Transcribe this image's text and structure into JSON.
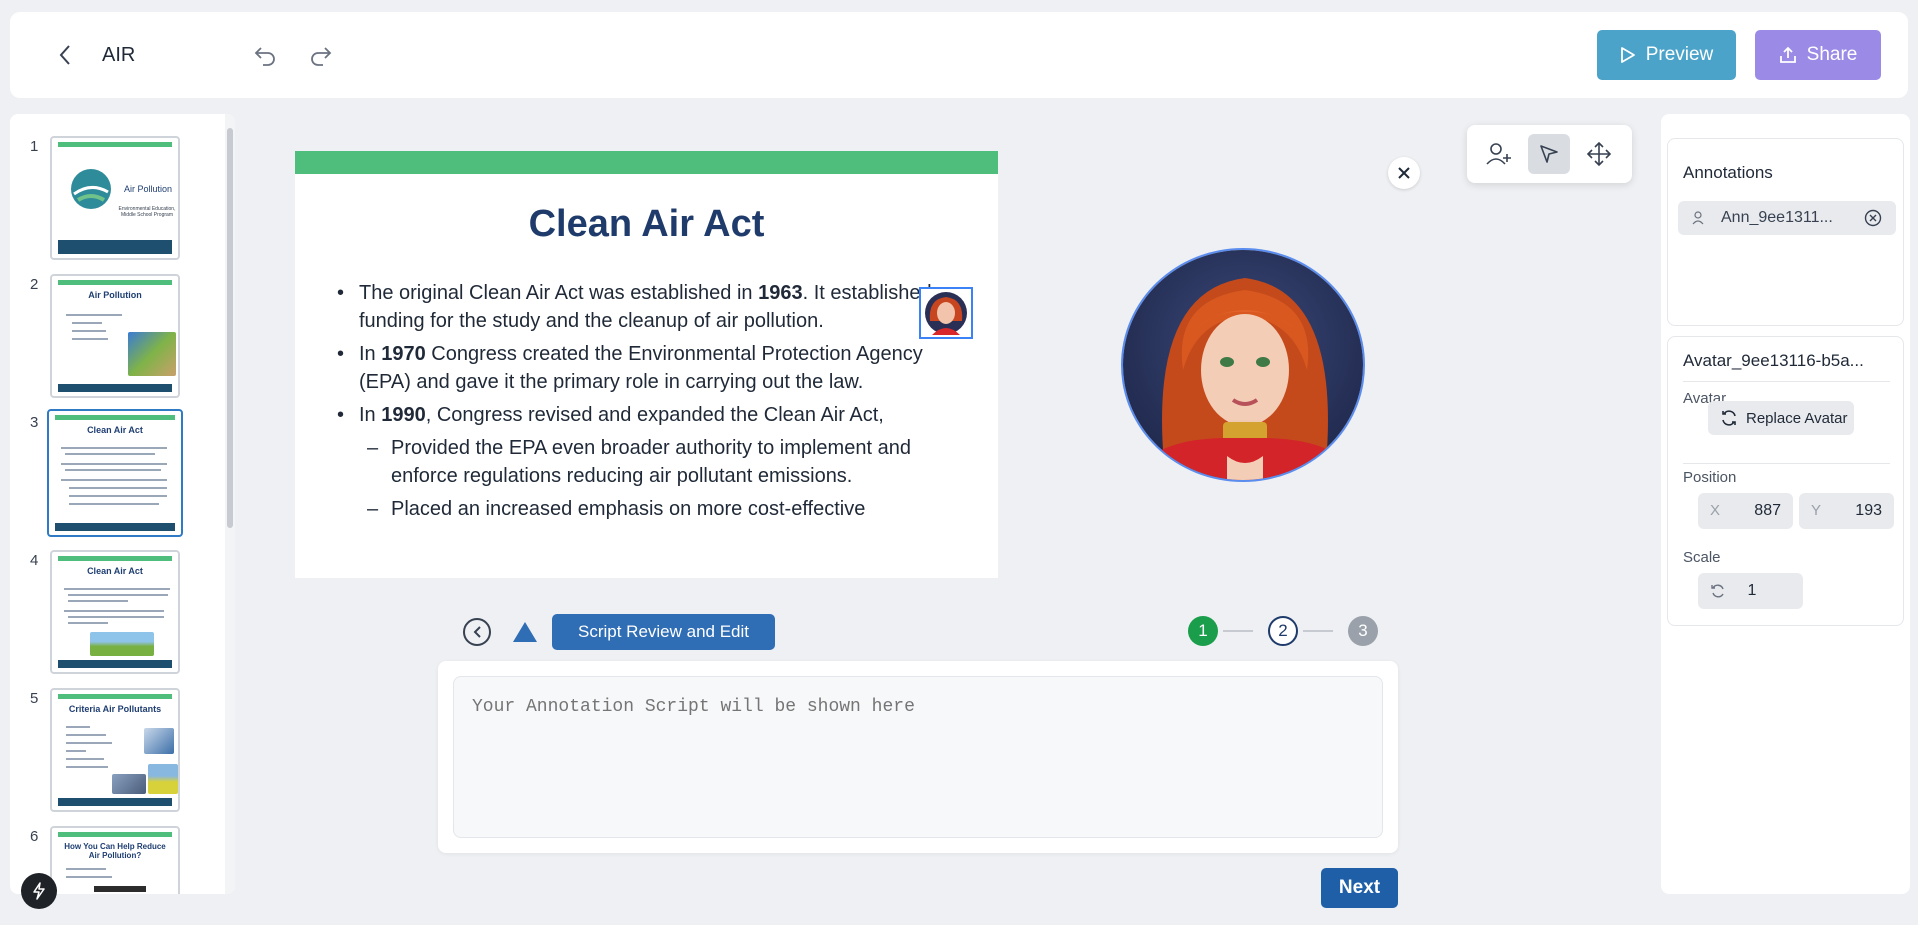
{
  "header": {
    "title": "AIR",
    "preview_label": "Preview",
    "share_label": "Share"
  },
  "slides": [
    {
      "number": "1",
      "title": "Air Pollution",
      "subtitle": "Environmental Education, Middle School Program"
    },
    {
      "number": "2",
      "title": "Air Pollution"
    },
    {
      "number": "3",
      "title": "Clean Air Act"
    },
    {
      "number": "4",
      "title": "Clean Air Act"
    },
    {
      "number": "5",
      "title": "Criteria Air Pollutants"
    },
    {
      "number": "6",
      "title": "How You Can Help Reduce Air Pollution?"
    }
  ],
  "current_slide": {
    "title": "Clean Air Act",
    "b1_pre": "The original Clean Air Act was established in ",
    "b1_bold": "1963",
    "b1_post": ".  It established funding for the study and the cleanup of air pollution.",
    "b2_pre": "In ",
    "b2_bold": "1970",
    "b2_post": " Congress created the Environmental Protection Agency (EPA) and gave it the primary role in carrying out the law.",
    "b3_pre": "In ",
    "b3_bold": "1990",
    "b3_post": ", Congress revised and expanded the Clean Air Act,",
    "sub1": "Provided the  EPA even broader authority to implement and enforce regulations reducing air pollutant emissions.",
    "sub2": "Placed an increased emphasis on more cost-effective"
  },
  "steps": {
    "label": "Script Review and Edit",
    "items": [
      "1",
      "2",
      "3"
    ]
  },
  "script": {
    "placeholder": "Your Annotation Script will be shown here"
  },
  "next_label": "Next",
  "annotations": {
    "title": "Annotations",
    "chip": "Ann_9ee1311..."
  },
  "properties": {
    "name": "Avatar_9ee13116-b5a...",
    "avatar_label": "Avatar",
    "replace_label": "Replace Avatar",
    "position_label": "Position",
    "x_axis": "X",
    "x_value": "887",
    "y_axis": "Y",
    "y_value": "193",
    "scale_label": "Scale",
    "scale_value": "1"
  },
  "colors": {
    "preview": "#4ba3c9",
    "share": "#9b8be6",
    "slide_accent": "#4fbe7d",
    "primary": "#1f5fa8",
    "step_done": "#1b9e4b"
  }
}
